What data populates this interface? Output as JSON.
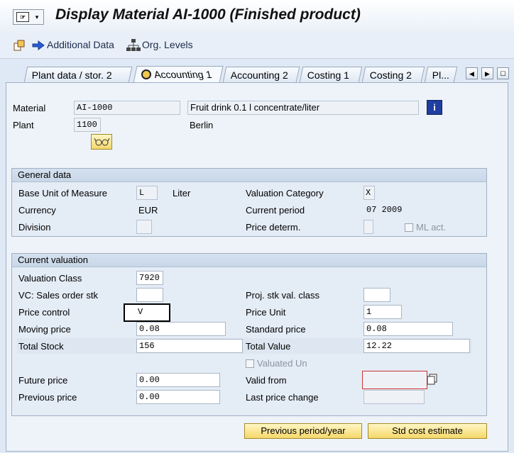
{
  "window": {
    "title": "Display Material AI-1000 (Finished product)"
  },
  "toolbar": {
    "additional_data": "Additional Data",
    "org_levels": "Org. Levels"
  },
  "tabs": [
    {
      "label": "Plant data / stor. 2"
    },
    {
      "label": "Accounting 1"
    },
    {
      "label": "Accounting 2"
    },
    {
      "label": "Costing 1"
    },
    {
      "label": "Costing 2"
    },
    {
      "label": "Pl..."
    }
  ],
  "header": {
    "material_label": "Material",
    "material_value": "AI-1000",
    "material_desc": "Fruit drink 0.1 l concentrate/liter",
    "plant_label": "Plant",
    "plant_value": "1100",
    "plant_name": "Berlin"
  },
  "general_data": {
    "title": "General data",
    "base_uom_label": "Base Unit of Measure",
    "base_uom_value": "L",
    "base_uom_text": "Liter",
    "valuation_category_label": "Valuation Category",
    "valuation_category_value": "X",
    "currency_label": "Currency",
    "currency_value": "EUR",
    "current_period_label": "Current period",
    "current_period_value": "07 2009",
    "division_label": "Division",
    "division_value": "",
    "price_determ_label": "Price determ.",
    "price_determ_value": "",
    "ml_act_label": "ML act."
  },
  "current_valuation": {
    "title": "Current valuation",
    "valuation_class_label": "Valuation Class",
    "valuation_class_value": "7920",
    "vc_sales_order_label": "VC: Sales order stk",
    "vc_sales_order_value": "",
    "proj_stk_label": "Proj. stk val. class",
    "proj_stk_value": "",
    "price_control_label": "Price control",
    "price_control_value": "V",
    "price_unit_label": "Price Unit",
    "price_unit_value": "1",
    "moving_price_label": "Moving price",
    "moving_price_value": "0.08",
    "standard_price_label": "Standard price",
    "standard_price_value": "0.08",
    "total_stock_label": "Total Stock",
    "total_stock_value": "156",
    "total_value_label": "Total Value",
    "total_value_value": "12.22",
    "valuated_un_label": "Valuated Un",
    "future_price_label": "Future price",
    "future_price_value": "0.00",
    "valid_from_label": "Valid from",
    "valid_from_value": "",
    "previous_price_label": "Previous price",
    "previous_price_value": "0.00",
    "last_price_change_label": "Last price change",
    "last_price_change_value": ""
  },
  "buttons": {
    "previous_period": "Previous period/year",
    "std_cost_estimate": "Std cost estimate"
  },
  "colors": {
    "background": "#dfe9f5",
    "button_yellow": "#f5d86b",
    "header_blue": "#c8d7e8"
  }
}
